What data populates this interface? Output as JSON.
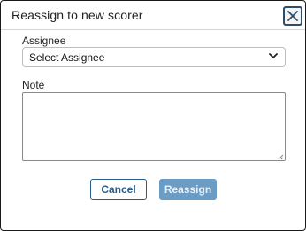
{
  "dialog": {
    "title": "Reassign to new scorer",
    "close_icon": "close-icon"
  },
  "assignee": {
    "label": "Assignee",
    "selected": "Select Assignee",
    "icon": "chevron-down-icon"
  },
  "note": {
    "label": "Note",
    "value": "",
    "placeholder": ""
  },
  "actions": {
    "cancel_label": "Cancel",
    "reassign_label": "Reassign",
    "reassign_enabled": false
  },
  "colors": {
    "primary": "#2a5c8a",
    "primary_disabled": "#6a9cc5",
    "border": "#bdbdbd"
  }
}
